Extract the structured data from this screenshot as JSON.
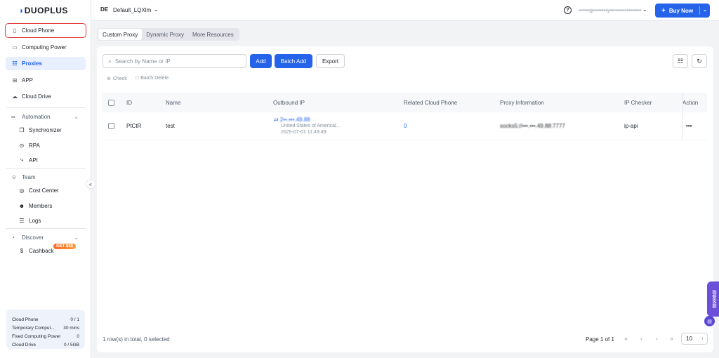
{
  "brand": {
    "logo_text": "DUOPLUS"
  },
  "sidebar": {
    "items": [
      {
        "label": "Cloud Phone",
        "icon": "phone-icon"
      },
      {
        "label": "Computing Power",
        "icon": "monitor-icon"
      },
      {
        "label": "Proxies",
        "icon": "proxy-icon"
      },
      {
        "label": "APP",
        "icon": "grid-icon"
      },
      {
        "label": "Cloud Drive",
        "icon": "cloud-icon"
      }
    ],
    "groups": {
      "automation": {
        "label": "Automation",
        "items": [
          "Synchronizer",
          "RPA",
          "API"
        ]
      },
      "team": {
        "label": "Team",
        "items": [
          "Cost Center",
          "Members",
          "Logs"
        ]
      },
      "discover": {
        "label": "Discover",
        "items": [
          "Cashback"
        ],
        "badge": "GET $$$"
      }
    },
    "usage": [
      {
        "label": "Cloud Phone",
        "value": "0 / 1"
      },
      {
        "label": "Temporary Comput...",
        "value": "30 mins"
      },
      {
        "label": "Fixed Computing Power",
        "value": "0"
      },
      {
        "label": "Cloud Drive",
        "value": "0 / 5GB"
      }
    ]
  },
  "header": {
    "workspace_badge": "DE",
    "workspace_name": "Default_LQXlm",
    "account": "••••••g••••••••y•••••••••••••••••",
    "buy_label": "Buy Now"
  },
  "tabs": [
    "Custom Proxy",
    "Dynamic Proxy",
    "More Resources"
  ],
  "toolbar": {
    "search_placeholder": "Search by Name or IP",
    "add_label": "Add",
    "batch_add_label": "Batch Add",
    "export_label": "Export",
    "check_label": "Check",
    "batch_delete_label": "Batch Delete"
  },
  "table": {
    "columns": [
      "ID",
      "Name",
      "Outbound IP",
      "Related Cloud Phone",
      "Proxy Information",
      "IP Checker",
      "Action"
    ],
    "rows": [
      {
        "id": "PtCtR",
        "name": "test",
        "outbound_ip": "2••.•••.49.88",
        "location": "United States of America(...",
        "time": "2025-07-01 11:43:49",
        "related_cloud_phone": "0",
        "proxy_info": "socks5://•••.•••.49.88:7777",
        "ip_checker": "ip-api",
        "action": "•••"
      }
    ]
  },
  "footer": {
    "summary": "1 row(s) in total, 0 selected",
    "page_label": "Page 1 of 1",
    "page_size": "10"
  },
  "support": {
    "label": "聯繫客服"
  }
}
